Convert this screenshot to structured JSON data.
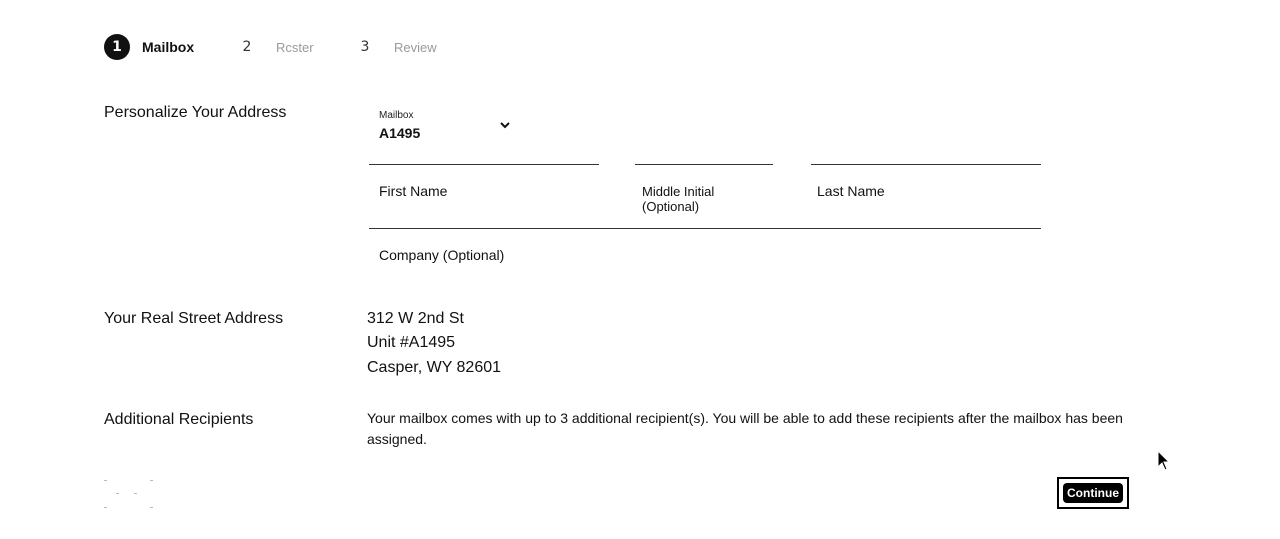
{
  "stepper": {
    "steps": [
      {
        "number": "1",
        "label": "Mailbox",
        "active": true
      },
      {
        "number": "2",
        "label": "Rcster",
        "active": false
      },
      {
        "number": "3",
        "label": "Review",
        "active": false
      }
    ]
  },
  "personalize": {
    "section_label": "Personalize Your Address",
    "mailbox_select": {
      "caption": "Mailbox",
      "value": "A1495"
    },
    "first_name_label": "First Name",
    "middle_initial_label_line1": "Middle Initial",
    "middle_initial_label_line2": "(Optional)",
    "last_name_label": "Last Name",
    "company_label": "Company (Optional)"
  },
  "street_address": {
    "section_label": "Your Real Street Address",
    "lines": [
      "312 W 2nd St",
      "Unit #A1495",
      "Casper, WY 82601"
    ]
  },
  "recipients": {
    "section_label": "Additional Recipients",
    "text": "Your mailbox comes with up to 3 additional recipient(s). You will be able to add these recipients after the mailbox has been assigned."
  },
  "actions": {
    "continue_label": "Continue"
  },
  "icons": {
    "dropdown": "chevron-down-icon",
    "pointer": "mouse-cursor-icon"
  },
  "colors": {
    "primary": "#000000",
    "text": "#111111",
    "muted": "#9a9a9a",
    "background": "#ffffff"
  }
}
